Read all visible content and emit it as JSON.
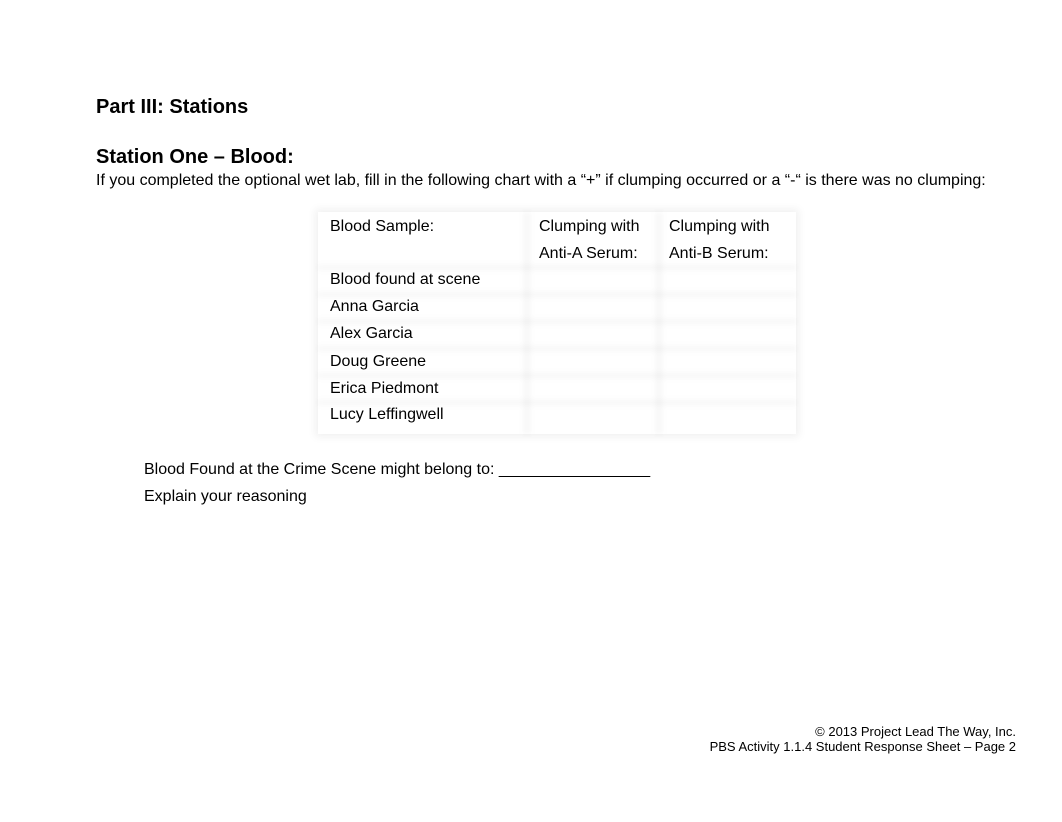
{
  "document": {
    "part_title": "Part III: Stations",
    "station_title": "Station One – Blood:",
    "instructions": "If you completed the optional wet lab, fill in the following chart with a “+” if clumping occurred or a “-“ is there was no clumping:",
    "table": {
      "headers": [
        {
          "line1": "Blood Sample:",
          "line2": ""
        },
        {
          "line1": "Clumping with",
          "line2": "Anti-A Serum:"
        },
        {
          "line1": "Clumping with",
          "line2": "Anti-B Serum:"
        }
      ],
      "rows": [
        {
          "sample": "Blood found at scene",
          "anti_a": "",
          "anti_b": ""
        },
        {
          "sample": "Anna Garcia",
          "anti_a": "",
          "anti_b": ""
        },
        {
          "sample": "Alex Garcia",
          "anti_a": "",
          "anti_b": ""
        },
        {
          "sample": "Doug Greene",
          "anti_a": "",
          "anti_b": ""
        },
        {
          "sample": "Erica Piedmont",
          "anti_a": "",
          "anti_b": ""
        },
        {
          "sample": "Lucy Leffingwell",
          "anti_a": "",
          "anti_b": ""
        }
      ]
    },
    "verdict_label": "Blood Found at the Crime Scene might belong to: _________________",
    "explain_label": "Explain your reasoning",
    "footer": {
      "copyright": "© 2013 Project Lead The Way, Inc.",
      "page_info": "PBS Activity 1.1.4 Student Response Sheet – Page 2"
    }
  }
}
